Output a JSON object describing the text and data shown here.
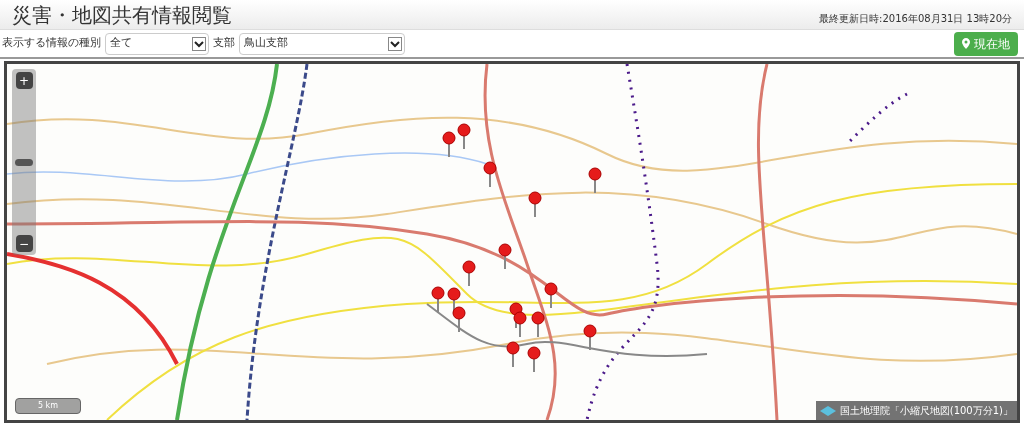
{
  "header": {
    "title": "災害・地図共有情報閲覧",
    "updated": "最終更新日時:2016年08月31日 13時20分"
  },
  "filters": [
    {
      "label": "表示する情報の種別",
      "value": "全て"
    },
    {
      "label": "支部",
      "value": "鳥山支部"
    }
  ],
  "location_button": {
    "label": "現在地"
  },
  "map": {
    "zoom": {
      "plus": "+",
      "minus": "−",
      "level": 0.5
    },
    "scale": "5 km",
    "attribution": "国土地理院「小縮尺地図(100万分1)」"
  }
}
